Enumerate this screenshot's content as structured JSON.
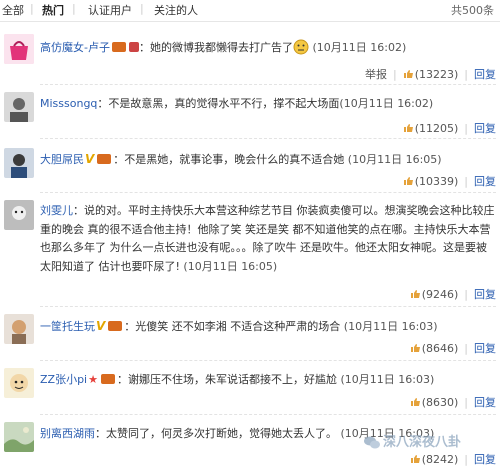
{
  "tabs": {
    "all": "全部",
    "hot": "热门",
    "verified": "认证用户",
    "following": "关注的人",
    "total": "共500条"
  },
  "actions": {
    "report": "举报",
    "reply": "回复"
  },
  "comments": [
    {
      "user": "高仿魔女-卢子",
      "text": "：她的微博我都懒得去打广告了",
      "time": "(10月11日 16:02)",
      "likes": "(13223)",
      "has_report": true,
      "badges": [
        "tag",
        "tag2",
        "emoji"
      ]
    },
    {
      "user": "Misssongq",
      "text": "：不是故意黑，真的觉得水平不行，撑不起大场面",
      "time": "(10月11日 16:02)",
      "likes": "(11205)",
      "has_report": false,
      "badges": []
    },
    {
      "user": "大胆屌民",
      "text": "：不是黑她，就事论事，晚会什么的真不适合她",
      "time": "(10月11日 16:05)",
      "likes": "(10339)",
      "has_report": false,
      "badges": [
        "v",
        "tag"
      ]
    },
    {
      "user": "刘雯儿",
      "text": "：说的对。平时主持快乐大本营这种综艺节目 你装疯卖傻可以。想演奖晚会这种比较庄重的晚会 真的很不适合他主持！他除了笑 笑还是笑 都不知道他笑的点在哪。主持快乐大本营也那么多年了 为什么一点长进也没有呢。。。除了吹牛 还是吹牛。他还太阳女神呢。这是要被太阳知道了 估计也要吓尿了!",
      "time": "(10月11日 16:05)",
      "likes": "(9246)",
      "has_report": false,
      "badges": []
    },
    {
      "user": "一筐托生玩",
      "text": "：光傻笑 还不如李湘 不适合这种严肃的场合",
      "time": "(10月11日 16:03)",
      "likes": "(8646)",
      "has_report": false,
      "badges": [
        "v",
        "tag"
      ]
    },
    {
      "user": "ZZ张小pi",
      "text": "：谢娜压不住场，朱军说话都接不上，好尴尬",
      "time": "(10月11日 16:03)",
      "likes": "(8630)",
      "has_report": false,
      "badges": [
        "star",
        "tag"
      ]
    },
    {
      "user": "别离西湖雨",
      "text": "：太赞同了，何灵多次打断她，觉得她太丢人了。",
      "time": "(10月11日 16:03)",
      "likes": "(8242)",
      "has_report": false,
      "badges": []
    }
  ],
  "watermark": "深八深夜八卦",
  "colors": {
    "link": "#2a5db0",
    "text": "#333333",
    "vip": "#e3a600",
    "tag": "#d86a1e"
  }
}
